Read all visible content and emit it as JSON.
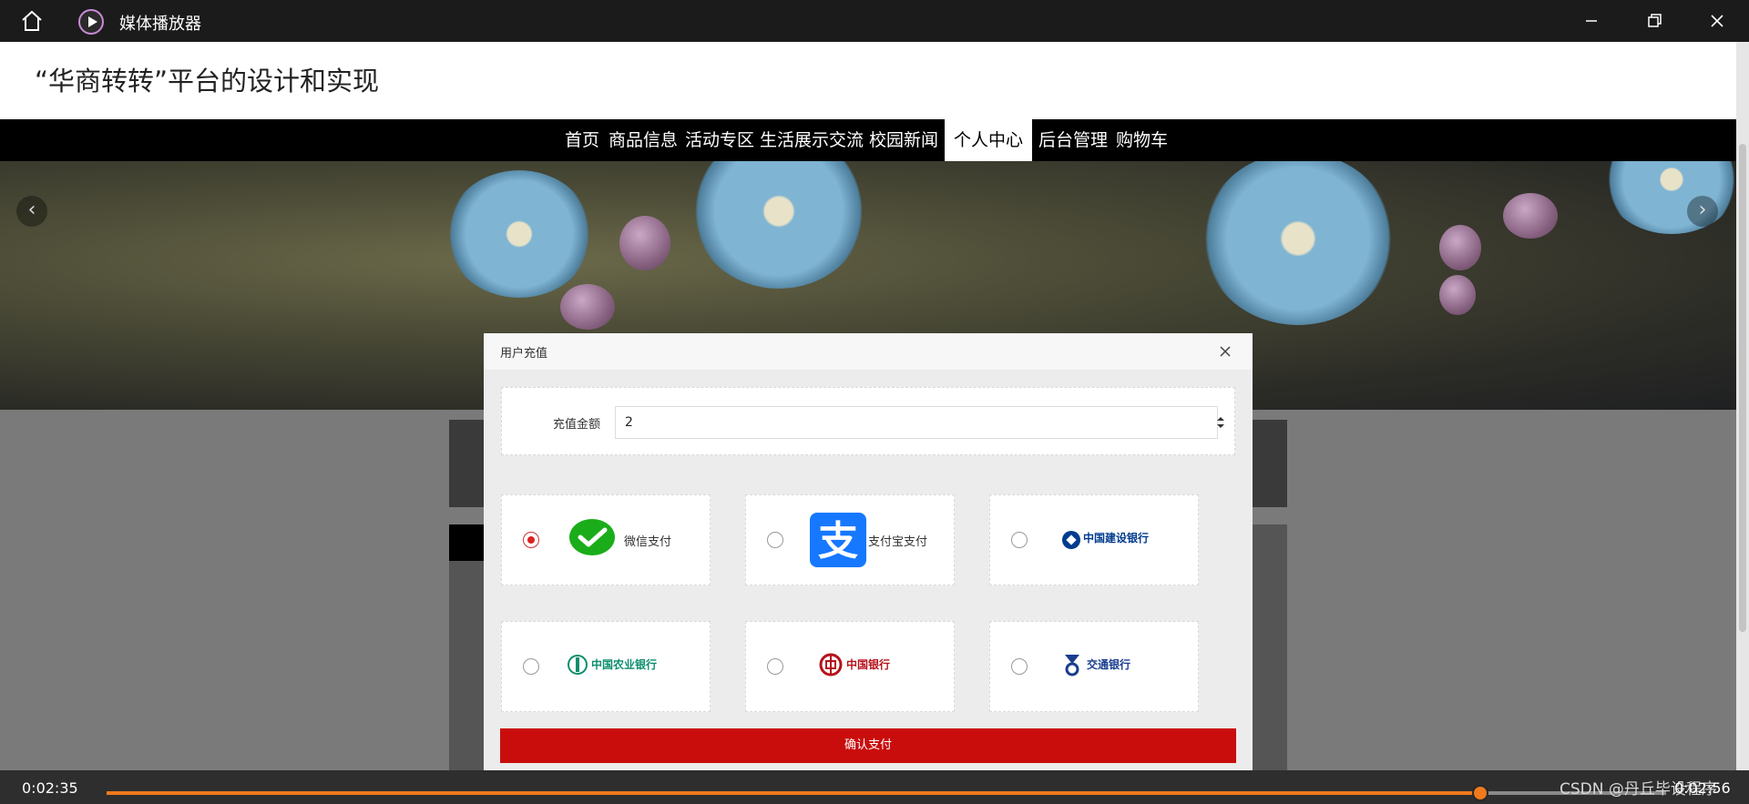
{
  "player": {
    "title": "媒体播放器",
    "current_time": "0:02:35",
    "total_time": "0:02:56",
    "progress": 0.8807,
    "watermark": "CSDN @丹丘毕设程序"
  },
  "site": {
    "title": "“华商转转”平台的设计和实现",
    "nav": [
      "首页",
      "商品信息",
      "活动专区",
      "生活展示交流",
      "校园新闻",
      "个人中心",
      "后台管理",
      "购物车"
    ],
    "active_nav": "个人中心"
  },
  "modal": {
    "title": "用户充值",
    "amount_label": "充值金额",
    "amount_value": "2",
    "payment_options": [
      {
        "label": "微信支付",
        "checked": true
      },
      {
        "label": "支付宝支付",
        "checked": false
      },
      {
        "label": "中国建设银行",
        "checked": false
      },
      {
        "label": "中国农业银行",
        "checked": false
      },
      {
        "label": "中国银行",
        "checked": false
      },
      {
        "label": "交通银行",
        "checked": false
      }
    ],
    "confirm_label": "确认支付"
  },
  "colors": {
    "accent": "#c90d0d",
    "progress": "#f07a1c",
    "wechat": "#1aad19",
    "alipay": "#1678ff"
  }
}
